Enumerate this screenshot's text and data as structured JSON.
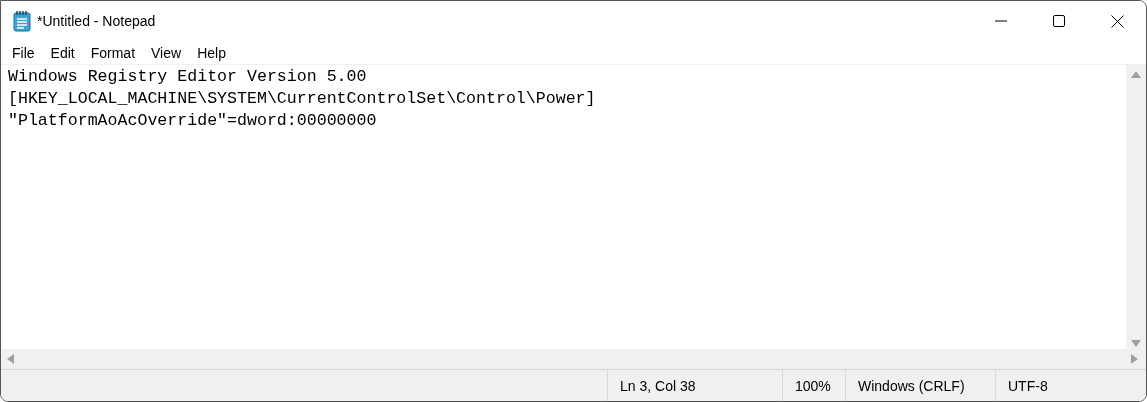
{
  "window": {
    "title": "*Untitled - Notepad"
  },
  "menu": [
    "File",
    "Edit",
    "Format",
    "View",
    "Help"
  ],
  "editor": {
    "lines": [
      "Windows Registry Editor Version 5.00",
      "[HKEY_LOCAL_MACHINE\\SYSTEM\\CurrentControlSet\\Control\\Power]",
      "\"PlatformAoAcOverride\"=dword:00000000"
    ]
  },
  "status_bar": [
    "Ln 3, Col 38",
    "100%",
    "Windows (CRLF)",
    "UTF-8"
  ]
}
